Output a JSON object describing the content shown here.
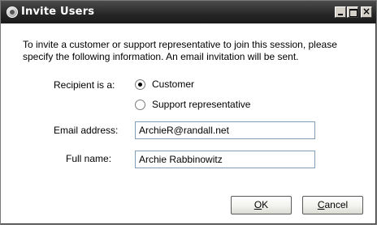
{
  "window": {
    "title": "Invite Users",
    "minimize_icon": "minimize-icon",
    "maximize_icon": "maximize-icon",
    "close_icon": "close-icon",
    "close_glyph": "×"
  },
  "intro_text": "To invite a customer or support representative to join this session, please specify the following information. An email invitation will be sent.",
  "recipient": {
    "label": "Recipient is a:",
    "options": [
      {
        "label": "Customer",
        "selected": true
      },
      {
        "label": "Support representative",
        "selected": false
      }
    ]
  },
  "email": {
    "label": "Email address:",
    "value": "ArchieR@randall.net"
  },
  "fullname": {
    "label": "Full name:",
    "value": "Archie Rabbinowitz"
  },
  "buttons": {
    "ok_mnemonic": "O",
    "ok_rest": "K",
    "cancel_mnemonic": "C",
    "cancel_rest": "ancel"
  }
}
